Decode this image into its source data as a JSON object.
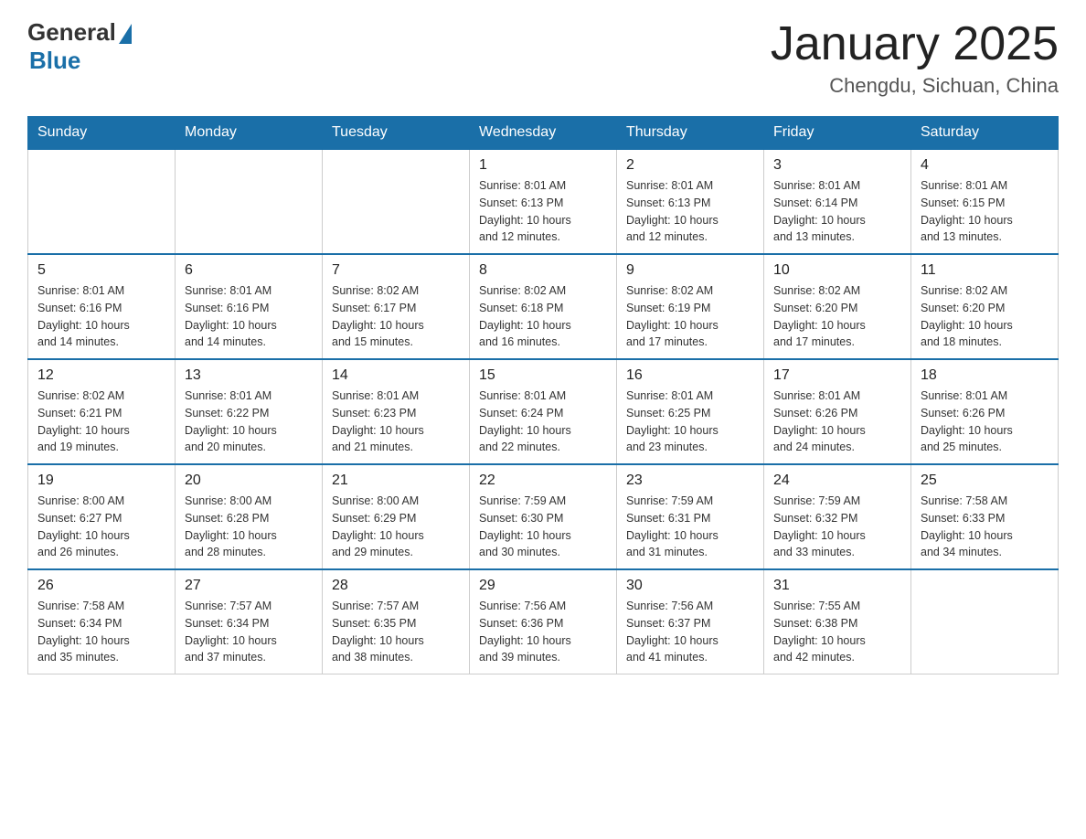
{
  "logo": {
    "general": "General",
    "blue": "Blue"
  },
  "title": "January 2025",
  "location": "Chengdu, Sichuan, China",
  "days_of_week": [
    "Sunday",
    "Monday",
    "Tuesday",
    "Wednesday",
    "Thursday",
    "Friday",
    "Saturday"
  ],
  "weeks": [
    [
      {
        "day": "",
        "info": ""
      },
      {
        "day": "",
        "info": ""
      },
      {
        "day": "",
        "info": ""
      },
      {
        "day": "1",
        "info": "Sunrise: 8:01 AM\nSunset: 6:13 PM\nDaylight: 10 hours\nand 12 minutes."
      },
      {
        "day": "2",
        "info": "Sunrise: 8:01 AM\nSunset: 6:13 PM\nDaylight: 10 hours\nand 12 minutes."
      },
      {
        "day": "3",
        "info": "Sunrise: 8:01 AM\nSunset: 6:14 PM\nDaylight: 10 hours\nand 13 minutes."
      },
      {
        "day": "4",
        "info": "Sunrise: 8:01 AM\nSunset: 6:15 PM\nDaylight: 10 hours\nand 13 minutes."
      }
    ],
    [
      {
        "day": "5",
        "info": "Sunrise: 8:01 AM\nSunset: 6:16 PM\nDaylight: 10 hours\nand 14 minutes."
      },
      {
        "day": "6",
        "info": "Sunrise: 8:01 AM\nSunset: 6:16 PM\nDaylight: 10 hours\nand 14 minutes."
      },
      {
        "day": "7",
        "info": "Sunrise: 8:02 AM\nSunset: 6:17 PM\nDaylight: 10 hours\nand 15 minutes."
      },
      {
        "day": "8",
        "info": "Sunrise: 8:02 AM\nSunset: 6:18 PM\nDaylight: 10 hours\nand 16 minutes."
      },
      {
        "day": "9",
        "info": "Sunrise: 8:02 AM\nSunset: 6:19 PM\nDaylight: 10 hours\nand 17 minutes."
      },
      {
        "day": "10",
        "info": "Sunrise: 8:02 AM\nSunset: 6:20 PM\nDaylight: 10 hours\nand 17 minutes."
      },
      {
        "day": "11",
        "info": "Sunrise: 8:02 AM\nSunset: 6:20 PM\nDaylight: 10 hours\nand 18 minutes."
      }
    ],
    [
      {
        "day": "12",
        "info": "Sunrise: 8:02 AM\nSunset: 6:21 PM\nDaylight: 10 hours\nand 19 minutes."
      },
      {
        "day": "13",
        "info": "Sunrise: 8:01 AM\nSunset: 6:22 PM\nDaylight: 10 hours\nand 20 minutes."
      },
      {
        "day": "14",
        "info": "Sunrise: 8:01 AM\nSunset: 6:23 PM\nDaylight: 10 hours\nand 21 minutes."
      },
      {
        "day": "15",
        "info": "Sunrise: 8:01 AM\nSunset: 6:24 PM\nDaylight: 10 hours\nand 22 minutes."
      },
      {
        "day": "16",
        "info": "Sunrise: 8:01 AM\nSunset: 6:25 PM\nDaylight: 10 hours\nand 23 minutes."
      },
      {
        "day": "17",
        "info": "Sunrise: 8:01 AM\nSunset: 6:26 PM\nDaylight: 10 hours\nand 24 minutes."
      },
      {
        "day": "18",
        "info": "Sunrise: 8:01 AM\nSunset: 6:26 PM\nDaylight: 10 hours\nand 25 minutes."
      }
    ],
    [
      {
        "day": "19",
        "info": "Sunrise: 8:00 AM\nSunset: 6:27 PM\nDaylight: 10 hours\nand 26 minutes."
      },
      {
        "day": "20",
        "info": "Sunrise: 8:00 AM\nSunset: 6:28 PM\nDaylight: 10 hours\nand 28 minutes."
      },
      {
        "day": "21",
        "info": "Sunrise: 8:00 AM\nSunset: 6:29 PM\nDaylight: 10 hours\nand 29 minutes."
      },
      {
        "day": "22",
        "info": "Sunrise: 7:59 AM\nSunset: 6:30 PM\nDaylight: 10 hours\nand 30 minutes."
      },
      {
        "day": "23",
        "info": "Sunrise: 7:59 AM\nSunset: 6:31 PM\nDaylight: 10 hours\nand 31 minutes."
      },
      {
        "day": "24",
        "info": "Sunrise: 7:59 AM\nSunset: 6:32 PM\nDaylight: 10 hours\nand 33 minutes."
      },
      {
        "day": "25",
        "info": "Sunrise: 7:58 AM\nSunset: 6:33 PM\nDaylight: 10 hours\nand 34 minutes."
      }
    ],
    [
      {
        "day": "26",
        "info": "Sunrise: 7:58 AM\nSunset: 6:34 PM\nDaylight: 10 hours\nand 35 minutes."
      },
      {
        "day": "27",
        "info": "Sunrise: 7:57 AM\nSunset: 6:34 PM\nDaylight: 10 hours\nand 37 minutes."
      },
      {
        "day": "28",
        "info": "Sunrise: 7:57 AM\nSunset: 6:35 PM\nDaylight: 10 hours\nand 38 minutes."
      },
      {
        "day": "29",
        "info": "Sunrise: 7:56 AM\nSunset: 6:36 PM\nDaylight: 10 hours\nand 39 minutes."
      },
      {
        "day": "30",
        "info": "Sunrise: 7:56 AM\nSunset: 6:37 PM\nDaylight: 10 hours\nand 41 minutes."
      },
      {
        "day": "31",
        "info": "Sunrise: 7:55 AM\nSunset: 6:38 PM\nDaylight: 10 hours\nand 42 minutes."
      },
      {
        "day": "",
        "info": ""
      }
    ]
  ]
}
